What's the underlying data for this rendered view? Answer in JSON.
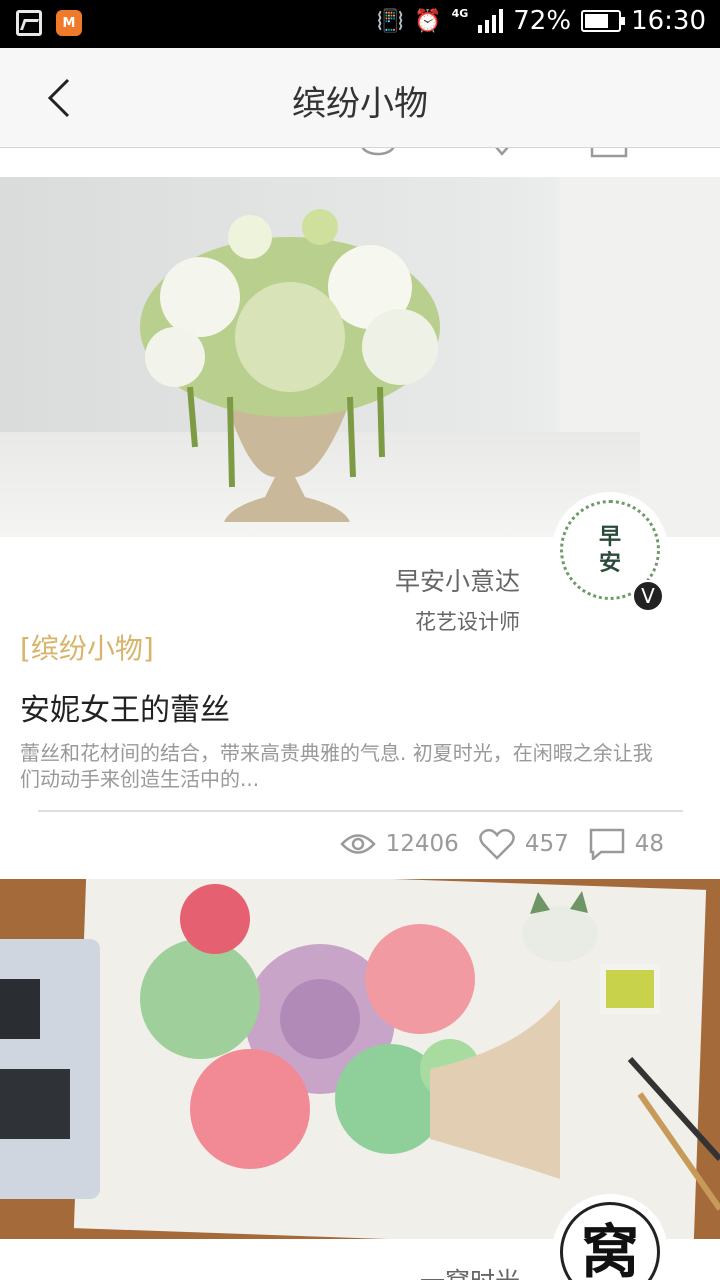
{
  "status_bar": {
    "battery": "72%",
    "time": "16:30",
    "network": "4G",
    "icons": [
      "gallery-icon",
      "app-icon",
      "vibrate-icon",
      "alarm-icon",
      "signal-icon",
      "battery-icon"
    ]
  },
  "app_bar": {
    "title": "缤纷小物",
    "back_icon": "chevron-left-icon"
  },
  "cards": [
    {
      "author_name": "早安小意达",
      "author_role": "花艺设计师",
      "avatar_text_1": "早",
      "avatar_text_2": "安",
      "verified_badge": "V",
      "category": "[缤纷小物]",
      "title": "安妮女王的蕾丝",
      "excerpt": "蕾丝和花材间的结合，带来高贵典雅的气息. 初夏时光，在闲暇之余让我们动动手来创造生活中的...",
      "views": "12406",
      "likes": "457",
      "comments": "48"
    },
    {
      "author_name": "一窝时光",
      "avatar_text_1": "窝"
    }
  ],
  "colors": {
    "category": "#d7b46a",
    "app_bar_bg": "#f7f7f7",
    "status_bar_bg": "#000000"
  }
}
